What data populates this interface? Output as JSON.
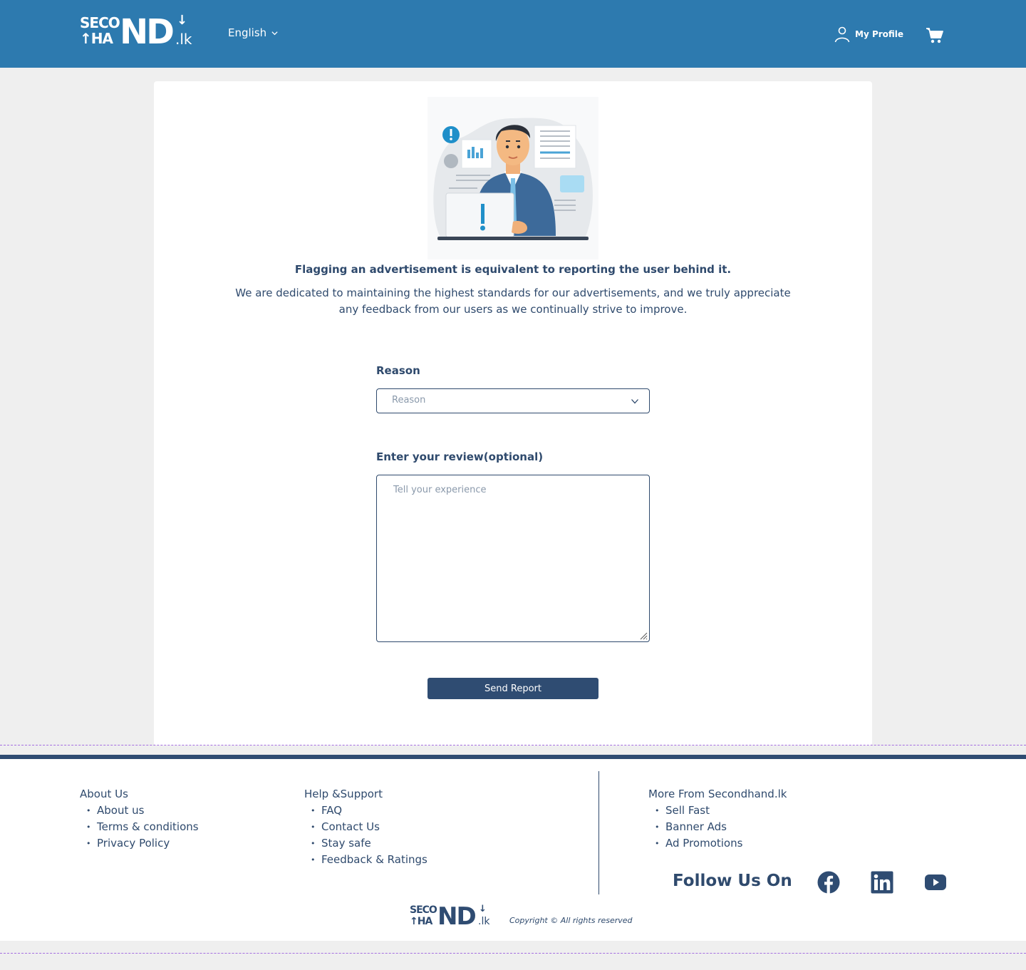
{
  "header": {
    "logo": {
      "top": "SECO",
      "bottom": "HA",
      "big": "ND",
      "suffix": ".lk"
    },
    "language": "English",
    "profile_label": "My Profile"
  },
  "main": {
    "headline": "Flagging an advertisement is equivalent to reporting the user behind it.",
    "description": "We are dedicated to maintaining the highest standards for our advertisements, and we truly appreciate any feedback from our users as we continually strive to improve.",
    "reason_label": "Reason",
    "reason_placeholder": "Reason",
    "review_label": "Enter your review(optional)",
    "review_placeholder": "Tell your experience",
    "send_button": "Send Report"
  },
  "footer": {
    "about": {
      "heading": "About Us",
      "items": [
        "About us",
        "Terms & conditions",
        "Privacy Policy"
      ]
    },
    "help": {
      "heading": "Help &Support",
      "items": [
        "FAQ",
        "Contact Us",
        "Stay safe",
        "Feedback & Ratings"
      ]
    },
    "more": {
      "heading": "More From Secondhand.lk",
      "items": [
        "Sell Fast",
        "Banner Ads",
        "Ad Promotions"
      ]
    },
    "follow_label": "Follow Us On",
    "copyright": "Copyright © All rights reserved"
  },
  "colors": {
    "header_bg": "#2d7aaf",
    "primary": "#2f4c72",
    "text": "#2f4a6d",
    "page_bg": "#efefef"
  },
  "icons": [
    "chevron-down-icon",
    "user-icon",
    "cart-icon",
    "facebook-icon",
    "linkedin-icon",
    "youtube-icon"
  ]
}
